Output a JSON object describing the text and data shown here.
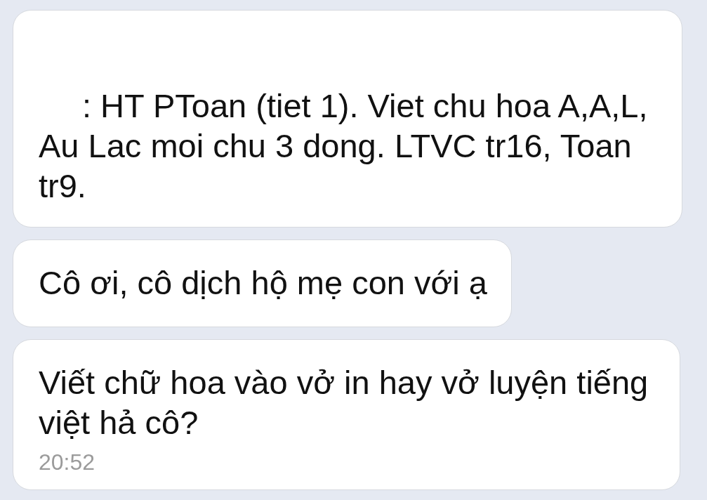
{
  "messages": [
    {
      "text": ": HT PToan (tiet 1). Viet chu hoa A,A,L, Au Lac moi chu 3 dong. LTVC tr16, Toan tr9.",
      "sender_hidden": true
    },
    {
      "text": "Cô ơi, cô dịch hộ mẹ con với ạ"
    },
    {
      "text": "Viết chữ hoa vào vở in hay vở luyện tiếng việt hả cô?",
      "time": "20:52"
    }
  ]
}
